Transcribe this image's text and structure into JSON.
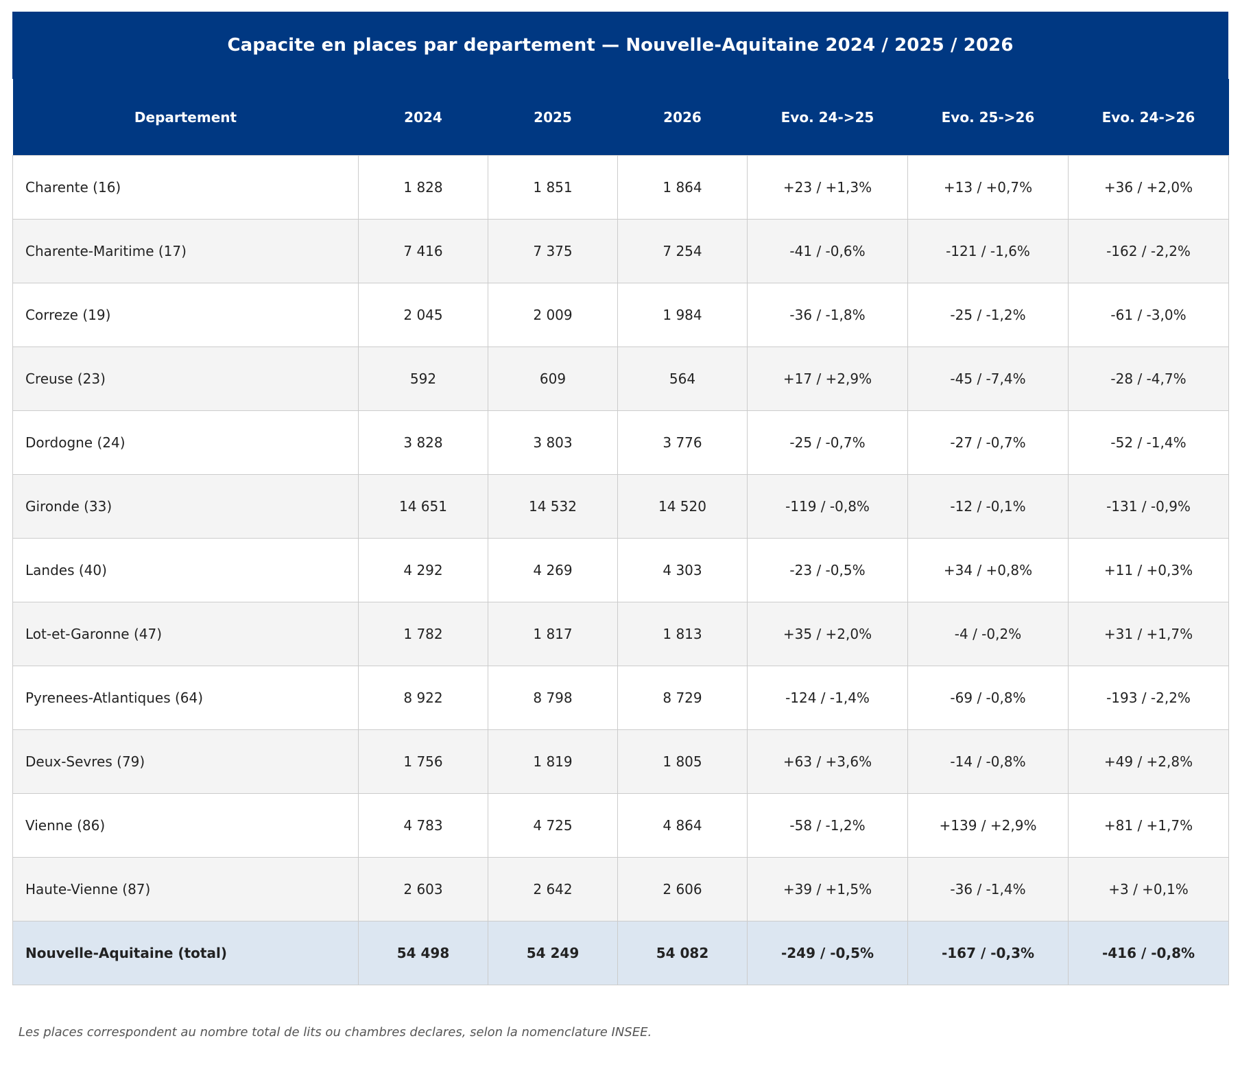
{
  "chart_data": {
    "type": "table",
    "title": "Capacite en places par departement — Nouvelle-Aquitaine 2024 / 2025 / 2026",
    "columns": [
      "Departement",
      "2024",
      "2025",
      "2026",
      "Evo. 24->25",
      "Evo. 25->26",
      "Evo. 24->26"
    ],
    "rows": [
      [
        "Charente (16)",
        "1 828",
        "1 851",
        "1 864",
        "+23 / +1,3%",
        "+13 / +0,7%",
        "+36 / +2,0%"
      ],
      [
        "Charente-Maritime (17)",
        "7 416",
        "7 375",
        "7 254",
        "-41 / -0,6%",
        "-121 / -1,6%",
        "-162 / -2,2%"
      ],
      [
        "Correze (19)",
        "2 045",
        "2 009",
        "1 984",
        "-36 / -1,8%",
        "-25 / -1,2%",
        "-61 / -3,0%"
      ],
      [
        "Creuse (23)",
        "592",
        "609",
        "564",
        "+17 / +2,9%",
        "-45 / -7,4%",
        "-28 / -4,7%"
      ],
      [
        "Dordogne (24)",
        "3 828",
        "3 803",
        "3 776",
        "-25 / -0,7%",
        "-27 / -0,7%",
        "-52 / -1,4%"
      ],
      [
        "Gironde (33)",
        "14 651",
        "14 532",
        "14 520",
        "-119 / -0,8%",
        "-12 / -0,1%",
        "-131 / -0,9%"
      ],
      [
        "Landes (40)",
        "4 292",
        "4 269",
        "4 303",
        "-23 / -0,5%",
        "+34 / +0,8%",
        "+11 / +0,3%"
      ],
      [
        "Lot-et-Garonne (47)",
        "1 782",
        "1 817",
        "1 813",
        "+35 / +2,0%",
        "-4 / -0,2%",
        "+31 / +1,7%"
      ],
      [
        "Pyrenees-Atlantiques (64)",
        "8 922",
        "8 798",
        "8 729",
        "-124 / -1,4%",
        "-69 / -0,8%",
        "-193 / -2,2%"
      ],
      [
        "Deux-Sevres (79)",
        "1 756",
        "1 819",
        "1 805",
        "+63 / +3,6%",
        "-14 / -0,8%",
        "+49 / +2,8%"
      ],
      [
        "Vienne (86)",
        "4 783",
        "4 725",
        "4 864",
        "-58 / -1,2%",
        "+139 / +2,9%",
        "+81 / +1,7%"
      ],
      [
        "Haute-Vienne (87)",
        "2 603",
        "2 642",
        "2 606",
        "+39 / +1,5%",
        "-36 / -1,4%",
        "+3 / +0,1%"
      ]
    ],
    "total_row": [
      "Nouvelle-Aquitaine (total)",
      "54 498",
      "54 249",
      "54 082",
      "-249 / -0,5%",
      "-167 / -0,3%",
      "-416 / -0,8%"
    ],
    "footnote": "Les places correspondent au nombre total de lits ou chambres declares, selon la nomenclature INSEE."
  },
  "colors": {
    "header_bg": "#003882",
    "header_text": "#ffffff",
    "row_alt_bg": "#f4f4f4",
    "total_bg": "#dce6f1",
    "grid": "#cccccc"
  }
}
